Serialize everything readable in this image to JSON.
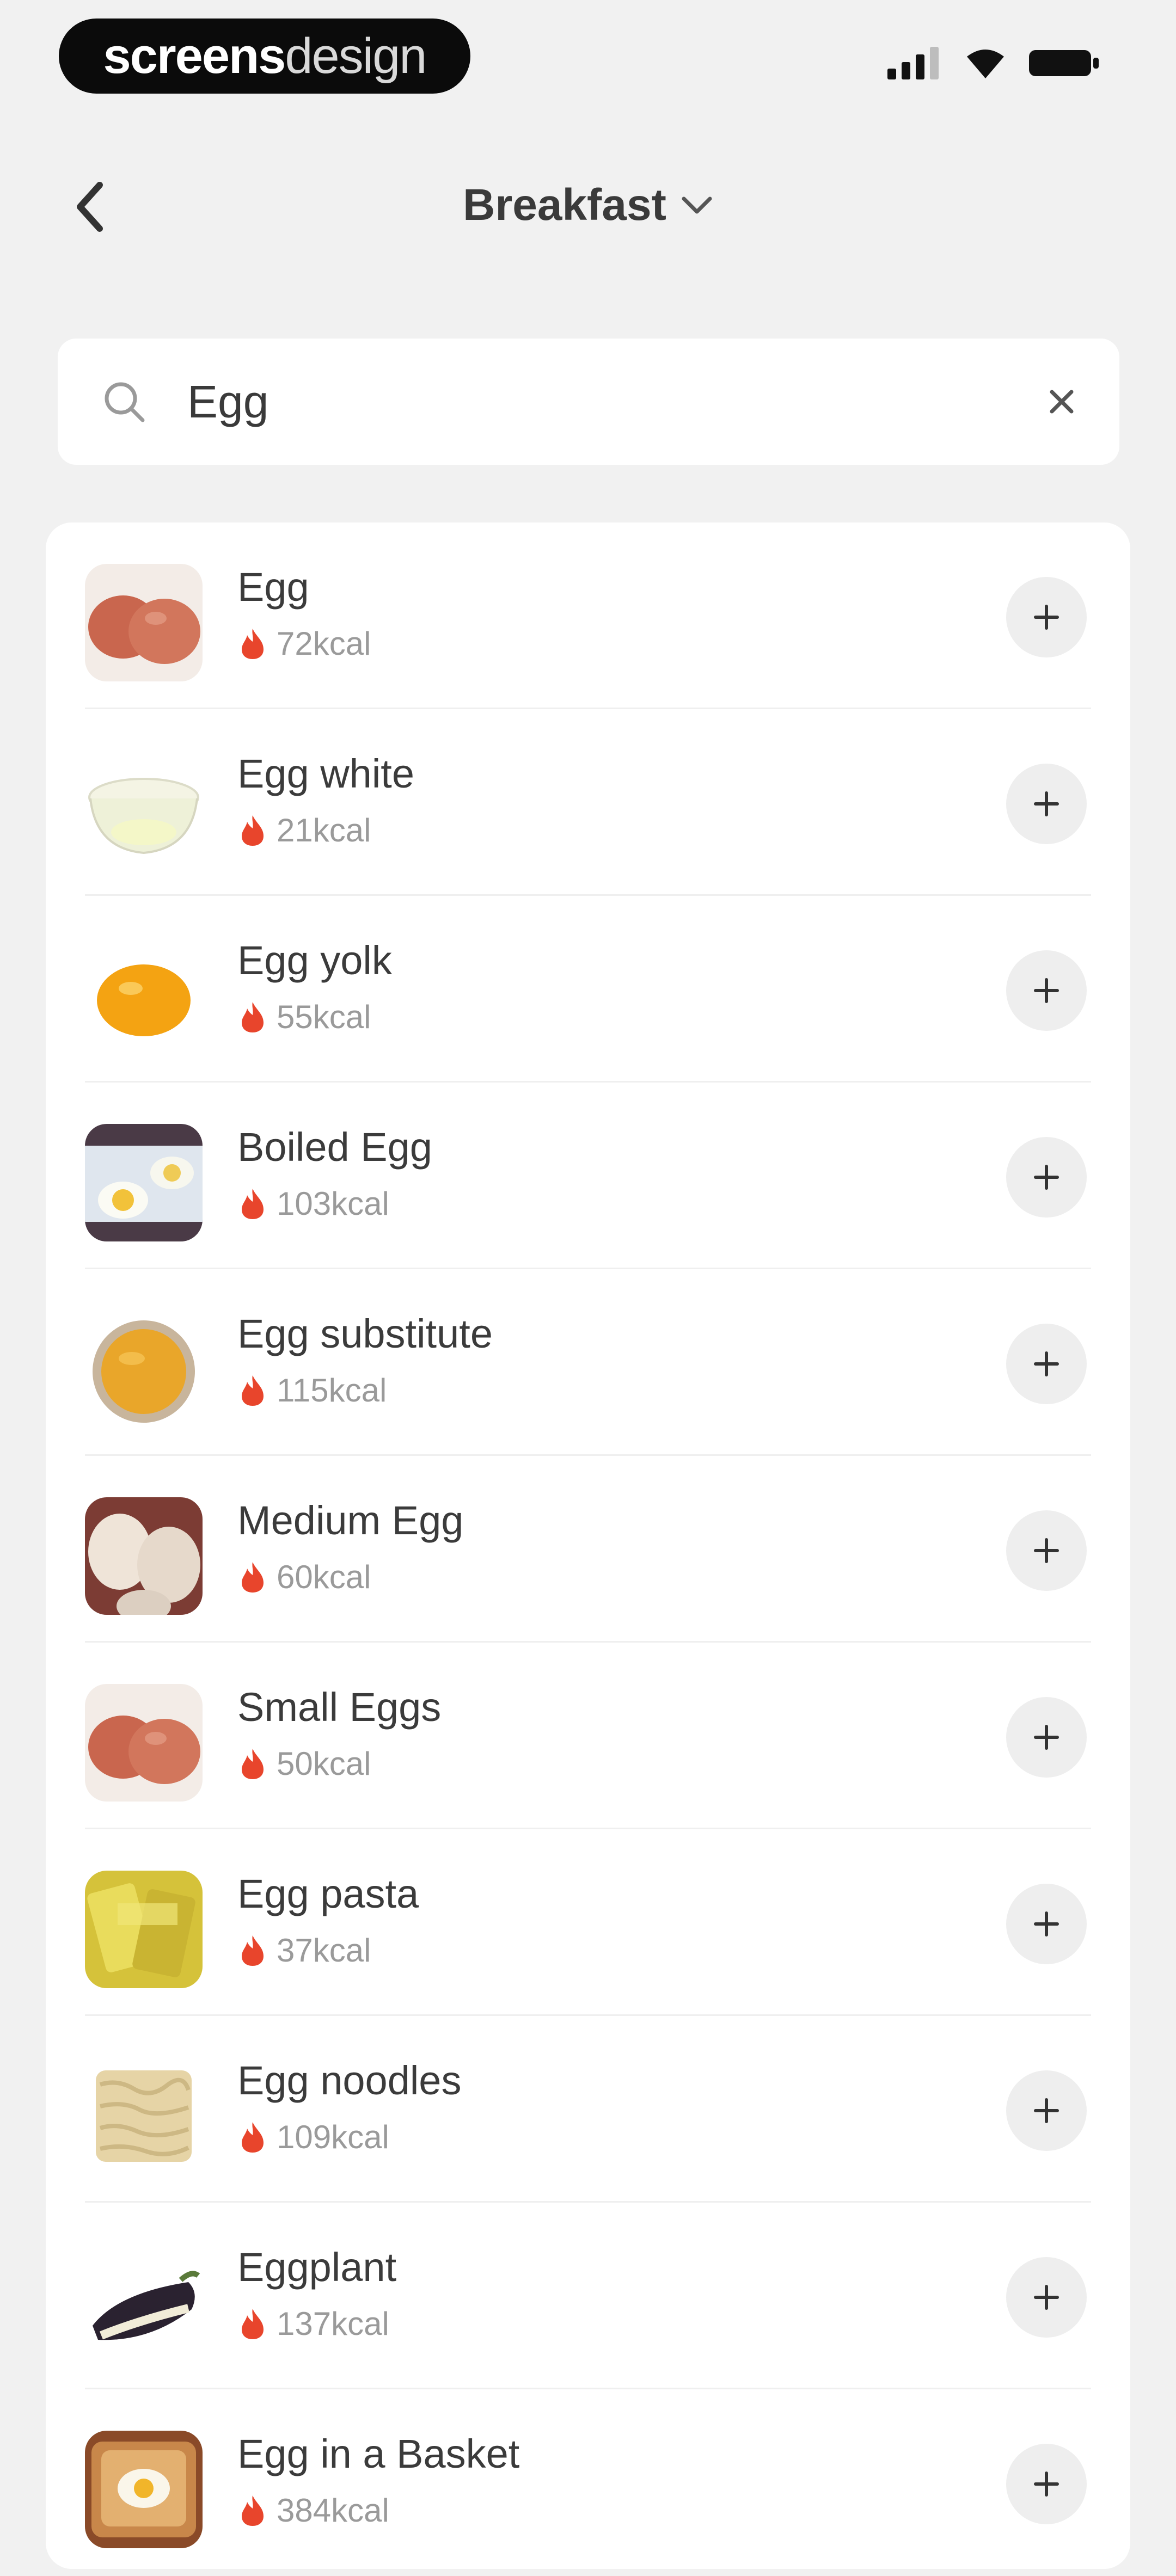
{
  "status_bar": {
    "brand_bold": "screens",
    "brand_light": "design",
    "icons": [
      "signal-icon",
      "wifi-icon",
      "battery-icon"
    ]
  },
  "header": {
    "title": "Breakfast",
    "back_icon": "chevron-left-icon",
    "dropdown_icon": "chevron-down-icon"
  },
  "search": {
    "value": "Egg",
    "placeholder": "",
    "icon": "search-icon",
    "clear_icon": "close-icon"
  },
  "colors": {
    "background": "#f1f1f1",
    "card": "#ffffff",
    "flame": "#e8452c",
    "add_button": "#eeeeee"
  },
  "results": [
    {
      "name": "Egg",
      "kcal": "72kcal",
      "thumb": "brown-eggs"
    },
    {
      "name": "Egg white",
      "kcal": "21kcal",
      "thumb": "egg-white-bowl"
    },
    {
      "name": "Egg yolk",
      "kcal": "55kcal",
      "thumb": "egg-yolk"
    },
    {
      "name": "Boiled Egg",
      "kcal": "103kcal",
      "thumb": "boiled-egg"
    },
    {
      "name": "Egg substitute",
      "kcal": "115kcal",
      "thumb": "egg-substitute-bowl"
    },
    {
      "name": "Medium Egg",
      "kcal": "60kcal",
      "thumb": "white-eggs"
    },
    {
      "name": "Small Eggs",
      "kcal": "50kcal",
      "thumb": "brown-eggs"
    },
    {
      "name": "Egg pasta",
      "kcal": "37kcal",
      "thumb": "egg-pasta"
    },
    {
      "name": "Egg noodles",
      "kcal": "109kcal",
      "thumb": "egg-noodles"
    },
    {
      "name": "Eggplant",
      "kcal": "137kcal",
      "thumb": "eggplant"
    },
    {
      "name": "Egg in a Basket",
      "kcal": "384kcal",
      "thumb": "egg-in-basket"
    }
  ]
}
